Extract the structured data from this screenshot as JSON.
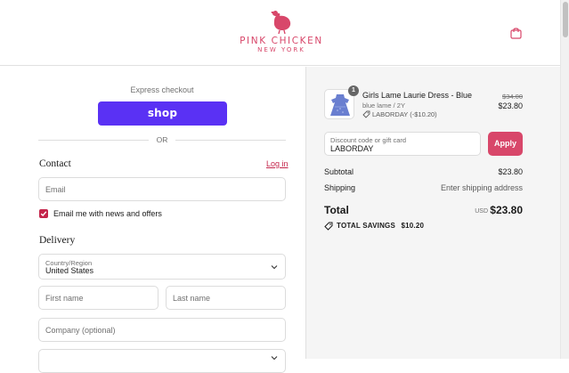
{
  "header": {
    "brand": "PINK CHICKEN",
    "brand_sub": "NEW YORK",
    "logo_icon": "chicken-logo-icon",
    "cart_icon": "shopping-bag-icon",
    "accent_color": "#d8476a"
  },
  "express": {
    "title": "Express checkout",
    "shop_button": "shop",
    "shop_color": "#5a31f4",
    "or_label": "OR"
  },
  "contact": {
    "title": "Contact",
    "login_link": "Log in",
    "email_placeholder": "Email",
    "newsletter_label": "Email me with news and offers",
    "newsletter_checked": true
  },
  "delivery": {
    "title": "Delivery",
    "country_label": "Country/Region",
    "country_value": "United States",
    "first_name_placeholder": "First name",
    "last_name_placeholder": "Last name",
    "company_placeholder": "Company (optional)"
  },
  "summary": {
    "item": {
      "quantity": "1",
      "name": "Girls Lame Laurie Dress - Blue",
      "variant": "blue lame / 2Y",
      "discount": "LABORDAY (-$10.20)",
      "original_price": "$34.00",
      "price": "$23.80"
    },
    "discount_field": {
      "label": "Discount code or gift card",
      "value": "LABORDAY",
      "apply_label": "Apply"
    },
    "subtotal_label": "Subtotal",
    "subtotal_value": "$23.80",
    "shipping_label": "Shipping",
    "shipping_value": "Enter shipping address",
    "total_label": "Total",
    "total_currency": "USD",
    "total_value": "$23.80",
    "savings_label": "TOTAL SAVINGS",
    "savings_value": "$10.20"
  }
}
